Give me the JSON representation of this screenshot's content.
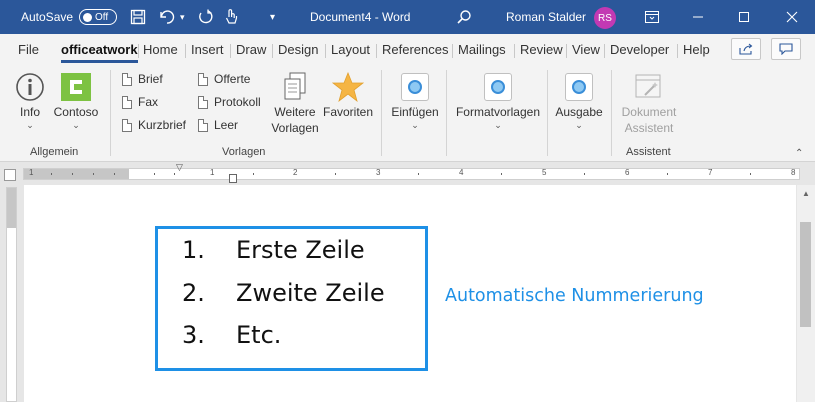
{
  "titlebar": {
    "autosave_label": "AutoSave",
    "autosave_state": "Off",
    "document_title": "Document4 - Word",
    "user_name": "Roman Stalder",
    "user_initials": "RS",
    "avatar_color": "#c239b3",
    "accent_color": "#2b579a",
    "qat_icons": [
      "save-icon",
      "undo-icon",
      "redo-icon",
      "touch-mode-icon",
      "customize-qat-icon"
    ],
    "search_icon": "search-icon",
    "window_buttons": [
      "ribbon-display-options-icon",
      "minimize-icon",
      "maximize-icon",
      "close-icon"
    ]
  },
  "tabs": [
    "File",
    "officeatwork",
    "Home",
    "Insert",
    "Draw",
    "Design",
    "Layout",
    "References",
    "Mailings",
    "Review",
    "View",
    "Developer",
    "Help"
  ],
  "active_tab": "officeatwork",
  "ribbon": {
    "allgemein": {
      "label": "Allgemein",
      "info_label": "Info",
      "contoso_label": "Contoso"
    },
    "vorlagen": {
      "label": "Vorlagen",
      "brief": "Brief",
      "fax": "Fax",
      "kurzbrief": "Kurzbrief",
      "offerte": "Offerte",
      "protokoll": "Protokoll",
      "leer": "Leer",
      "weitere_1": "Weitere",
      "weitere_2": "Vorlagen",
      "favoriten": "Favoriten"
    },
    "einfuegen_label": "Einfügen",
    "formatvorlagen_label": "Formatvorlagen",
    "ausgabe_label": "Ausgabe",
    "assistent": {
      "label": "Assistent",
      "dokument_1": "Dokument",
      "dokument_2": "Assistent"
    }
  },
  "ruler": {
    "numbers": [
      "1",
      "1",
      "2",
      "3",
      "4",
      "5",
      "6",
      "7",
      "8"
    ]
  },
  "document": {
    "list_items": [
      {
        "number": "1.",
        "text": "Erste Zeile"
      },
      {
        "number": "2.",
        "text": "Zweite Zeile"
      },
      {
        "number": "3.",
        "text": "Etc."
      }
    ],
    "annotation": "Automatische Nummerierung",
    "annotation_color": "#1e90e6"
  }
}
